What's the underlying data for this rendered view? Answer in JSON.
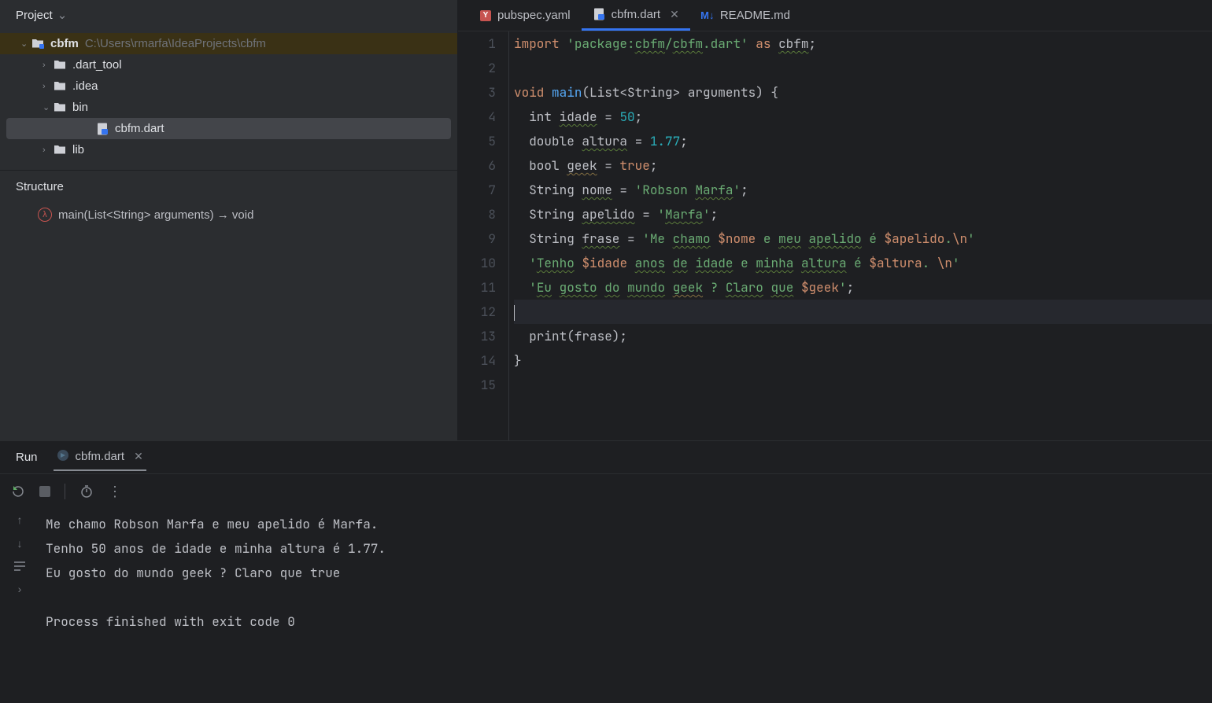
{
  "project": {
    "header": "Project",
    "root_name": "cbfm",
    "root_path": "C:\\Users\\rmarfa\\IdeaProjects\\cbfm",
    "items": [
      {
        "name": ".dart_tool",
        "expanded": false,
        "level": 1
      },
      {
        "name": ".idea",
        "expanded": false,
        "level": 1
      },
      {
        "name": "bin",
        "expanded": true,
        "level": 1
      },
      {
        "name": "cbfm.dart",
        "level": 2,
        "file": true,
        "selected": true
      },
      {
        "name": "lib",
        "expanded": false,
        "level": 1
      }
    ]
  },
  "structure": {
    "header": "Structure",
    "item": "main(List<String> arguments) → void"
  },
  "tabs": [
    {
      "label": "pubspec.yaml",
      "icon": "yaml"
    },
    {
      "label": "cbfm.dart",
      "icon": "dart",
      "active": true,
      "closable": true
    },
    {
      "label": "README.md",
      "icon": "md"
    }
  ],
  "code": {
    "lines": [
      {
        "n": "1",
        "t": [
          [
            "kw",
            "import"
          ],
          [
            "txt",
            " "
          ],
          [
            "str",
            "'package:"
          ],
          [
            "str squiggle",
            "cbfm"
          ],
          [
            "str",
            "/"
          ],
          [
            "str squiggle",
            "cbfm"
          ],
          [
            "str",
            ".dart'"
          ],
          [
            "txt",
            " "
          ],
          [
            "kw",
            "as"
          ],
          [
            "txt",
            " "
          ],
          [
            "txt squiggle",
            "cbfm"
          ],
          [
            "txt",
            ";"
          ]
        ]
      },
      {
        "n": "2",
        "t": []
      },
      {
        "n": "3",
        "t": [
          [
            "kw",
            "void"
          ],
          [
            "txt",
            " "
          ],
          [
            "fn",
            "main"
          ],
          [
            "txt",
            "(List<String> arguments) {"
          ]
        ]
      },
      {
        "n": "4",
        "t": [
          [
            "txt",
            "  int "
          ],
          [
            "txt squiggle",
            "idade"
          ],
          [
            "txt",
            " = "
          ],
          [
            "num",
            "50"
          ],
          [
            "txt",
            ";"
          ]
        ]
      },
      {
        "n": "5",
        "t": [
          [
            "txt",
            "  double "
          ],
          [
            "txt squiggle",
            "altura"
          ],
          [
            "txt",
            " = "
          ],
          [
            "num",
            "1.77"
          ],
          [
            "txt",
            ";"
          ]
        ]
      },
      {
        "n": "6",
        "t": [
          [
            "txt",
            "  bool "
          ],
          [
            "txt squiggle-y",
            "geek"
          ],
          [
            "txt",
            " = "
          ],
          [
            "kw",
            "true"
          ],
          [
            "txt",
            ";"
          ]
        ]
      },
      {
        "n": "7",
        "t": [
          [
            "txt",
            "  String "
          ],
          [
            "txt squiggle",
            "nome"
          ],
          [
            "txt",
            " = "
          ],
          [
            "str",
            "'Robson "
          ],
          [
            "str squiggle",
            "Marfa"
          ],
          [
            "str",
            "'"
          ],
          [
            "txt",
            ";"
          ]
        ]
      },
      {
        "n": "8",
        "t": [
          [
            "txt",
            "  String "
          ],
          [
            "txt squiggle",
            "apelido"
          ],
          [
            "txt",
            " = "
          ],
          [
            "str",
            "'"
          ],
          [
            "str squiggle",
            "Marfa"
          ],
          [
            "str",
            "'"
          ],
          [
            "txt",
            ";"
          ]
        ]
      },
      {
        "n": "9",
        "t": [
          [
            "txt",
            "  String "
          ],
          [
            "txt squiggle",
            "frase"
          ],
          [
            "txt",
            " = "
          ],
          [
            "str",
            "'Me "
          ],
          [
            "str squiggle",
            "chamo"
          ],
          [
            "str",
            " "
          ],
          [
            "interp",
            "$nome"
          ],
          [
            "str",
            " e "
          ],
          [
            "str squiggle",
            "meu"
          ],
          [
            "str",
            " "
          ],
          [
            "str squiggle",
            "apelido"
          ],
          [
            "str",
            " é "
          ],
          [
            "interp",
            "$apelido"
          ],
          [
            "str",
            "."
          ],
          [
            "interp",
            "\\n"
          ],
          [
            "str",
            "'"
          ]
        ]
      },
      {
        "n": "10",
        "t": [
          [
            "txt",
            "  "
          ],
          [
            "str",
            "'"
          ],
          [
            "str squiggle",
            "Tenho"
          ],
          [
            "str",
            " "
          ],
          [
            "interp",
            "$idade"
          ],
          [
            "str",
            " "
          ],
          [
            "str squiggle",
            "anos"
          ],
          [
            "str",
            " "
          ],
          [
            "str squiggle",
            "de"
          ],
          [
            "str",
            " "
          ],
          [
            "str squiggle",
            "idade"
          ],
          [
            "str",
            " e "
          ],
          [
            "str squiggle",
            "minha"
          ],
          [
            "str",
            " "
          ],
          [
            "str squiggle",
            "altura"
          ],
          [
            "str",
            " é "
          ],
          [
            "interp",
            "$altura"
          ],
          [
            "str",
            ". "
          ],
          [
            "interp",
            "\\n"
          ],
          [
            "str",
            "'"
          ]
        ]
      },
      {
        "n": "11",
        "t": [
          [
            "txt",
            "  "
          ],
          [
            "str",
            "'"
          ],
          [
            "str squiggle",
            "Eu"
          ],
          [
            "str",
            " "
          ],
          [
            "str squiggle",
            "gosto"
          ],
          [
            "str",
            " "
          ],
          [
            "str squiggle",
            "do"
          ],
          [
            "str",
            " "
          ],
          [
            "str squiggle",
            "mundo"
          ],
          [
            "str",
            " "
          ],
          [
            "str squiggle-y",
            "geek"
          ],
          [
            "str",
            " ? "
          ],
          [
            "str squiggle",
            "Claro"
          ],
          [
            "str",
            " "
          ],
          [
            "str squiggle",
            "que"
          ],
          [
            "str",
            " "
          ],
          [
            "interp",
            "$geek"
          ],
          [
            "str",
            "'"
          ],
          [
            "txt",
            ";"
          ]
        ]
      },
      {
        "n": "12",
        "t": [],
        "current": true
      },
      {
        "n": "13",
        "t": [
          [
            "txt",
            "  print(frase);"
          ]
        ]
      },
      {
        "n": "14",
        "t": [
          [
            "txt",
            "}"
          ]
        ]
      },
      {
        "n": "15",
        "t": []
      }
    ]
  },
  "run": {
    "label": "Run",
    "tab": "cbfm.dart",
    "output": [
      "Me chamo Robson Marfa e meu apelido é Marfa.",
      "Tenho 50 anos de idade e minha altura é 1.77.",
      "Eu gosto do mundo geek ? Claro que true",
      "",
      "Process finished with exit code 0"
    ]
  }
}
